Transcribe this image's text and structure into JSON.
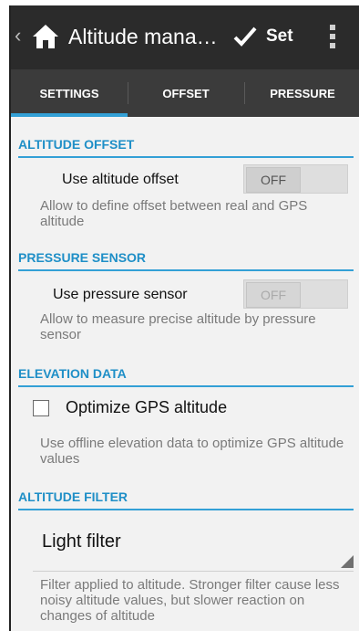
{
  "action_bar": {
    "title": "Altitude mana…",
    "set_label": "Set"
  },
  "tabs": [
    {
      "label": "SETTINGS",
      "active": true
    },
    {
      "label": "OFFSET",
      "active": false
    },
    {
      "label": "PRESSURE",
      "active": false
    }
  ],
  "sections": {
    "altitude_offset": {
      "header": "ALTITUDE OFFSET",
      "label": "Use altitude offset",
      "toggle": "OFF",
      "summary": "Allow to define offset between real and GPS altitude"
    },
    "pressure_sensor": {
      "header": "PRESSURE SENSOR",
      "label": "Use pressure sensor",
      "toggle": "OFF",
      "summary": "Allow to measure precise altitude by pressure sensor"
    },
    "elevation_data": {
      "header": "ELEVATION DATA",
      "checkbox_label": "Optimize GPS altitude",
      "checked": false,
      "summary": "Use offline elevation data to optimize GPS altitude values"
    },
    "altitude_filter": {
      "header": "ALTITUDE FILTER",
      "selected": "Light filter",
      "summary": "Filter applied to altitude. Stronger filter cause less noisy altitude values, but slower reaction on changes of altitude"
    }
  },
  "colors": {
    "accent": "#33a0d6",
    "header_text": "#1f8fc7",
    "action_bar": "#2b2b2b",
    "tab_bar": "#3b3b3b",
    "background": "#f2f2f2"
  }
}
